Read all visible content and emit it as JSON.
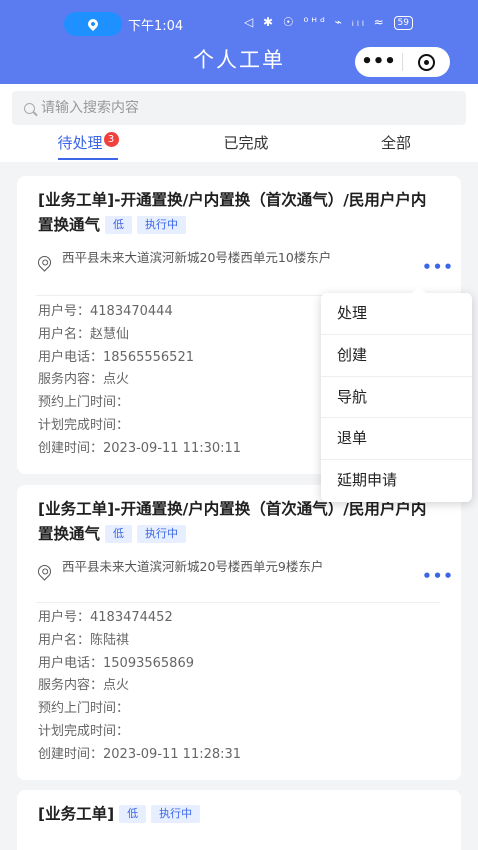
{
  "status_bar": {
    "time": "下午1:04",
    "icons": "◁ ✱ ☉ ⁰ᴴᵈ ⌁ ᵢₗₗ ≈",
    "battery": "59"
  },
  "header": {
    "title": "个人工单",
    "more_label": "•••"
  },
  "search": {
    "placeholder": "请输入搜索内容",
    "value": ""
  },
  "tabs": [
    {
      "label": "待处理",
      "badge": "3",
      "active": true
    },
    {
      "label": "已完成",
      "active": false
    },
    {
      "label": "全部",
      "active": false
    }
  ],
  "cards": [
    {
      "title": "[业务工单]-开通置换/户内置换（首次通气）/民用户户内置换通气",
      "priority": "低",
      "status": "执行中",
      "address": "西平县未来大道滨河新城20号楼西单元10楼东户",
      "more": "•••",
      "fields": [
        "用户号：4183470444",
        "用户名：赵慧仙",
        "用户电话：18565556521",
        "服务内容：点火",
        "预约上门时间：",
        "计划完成时间：",
        "创建时间：2023-09-11 11:30:11"
      ]
    },
    {
      "title": "[业务工单]-开通置换/户内置换（首次通气）/民用户户内置换通气",
      "priority": "低",
      "status": "执行中",
      "address": "西平县未来大道滨河新城20号楼西单元9楼东户",
      "more": "•••",
      "fields": [
        "用户号：4183474452",
        "用户名：陈陆祺",
        "用户电话：15093565869",
        "服务内容：点火",
        "预约上门时间：",
        "计划完成时间：",
        "创建时间：2023-09-11 11:28:31"
      ]
    },
    {
      "title": "[业务工单]",
      "priority": "低",
      "status": "执行中"
    }
  ],
  "menu": {
    "items": [
      "处理",
      "创建",
      "导航",
      "退单",
      "延期申请"
    ]
  },
  "colors": {
    "primary": "#3b66e8",
    "header": "#5b7bf0",
    "badge": "#f0413e"
  }
}
